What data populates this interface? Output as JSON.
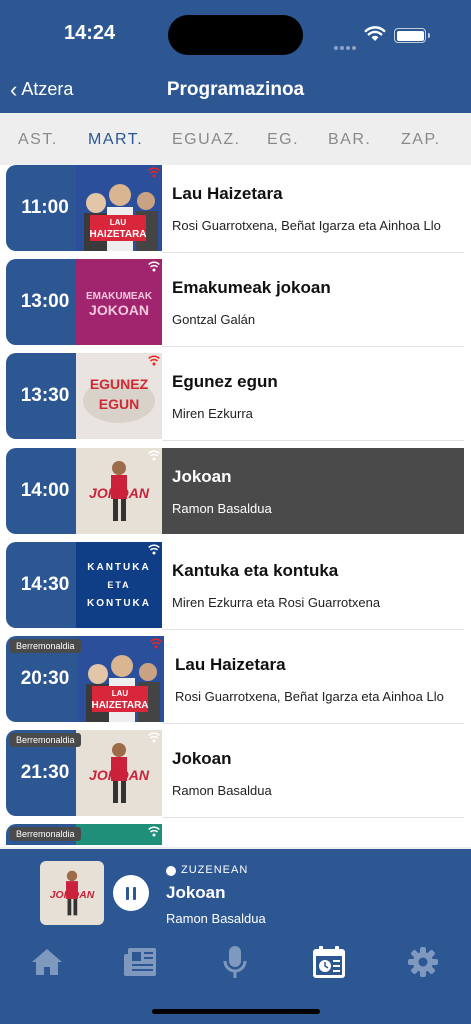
{
  "status_bar": {
    "time": "14:24"
  },
  "nav": {
    "back_label": "Atzera",
    "title": "Programazinoa"
  },
  "days": [
    {
      "label": "AST.",
      "active": false
    },
    {
      "label": "MART.",
      "active": true
    },
    {
      "label": "EGUAZ.",
      "active": false
    },
    {
      "label": "EG.",
      "active": false
    },
    {
      "label": "BAR.",
      "active": false
    },
    {
      "label": "ZAP.",
      "active": false
    }
  ],
  "programs": [
    {
      "time": "11:00",
      "title": "Lau Haizetara",
      "hosts": "Rosi Guarrotxena, Beñat Igarza eta Ainhoa Llo",
      "thumb": "lau-haizetara",
      "current": false,
      "badge": ""
    },
    {
      "time": "13:00",
      "title": "Emakumeak jokoan",
      "hosts": "Gontzal Galán",
      "thumb": "emakumeak-jokoan",
      "current": false,
      "badge": ""
    },
    {
      "time": "13:30",
      "title": "Egunez egun",
      "hosts": "Miren Ezkurra",
      "thumb": "egunez-egun",
      "current": false,
      "badge": ""
    },
    {
      "time": "14:00",
      "title": "Jokoan",
      "hosts": "Ramon Basaldua",
      "thumb": "jokoan",
      "current": true,
      "badge": ""
    },
    {
      "time": "14:30",
      "title": "Kantuka eta kontuka",
      "hosts": "Miren Ezkurra eta Rosi Guarrotxena",
      "thumb": "kantuka",
      "current": false,
      "badge": ""
    },
    {
      "time": "20:30",
      "title": "Lau Haizetara",
      "hosts": "Rosi Guarrotxena, Beñat Igarza eta Ainhoa Llo",
      "thumb": "lau-haizetara",
      "current": false,
      "badge": "Berremonaldia"
    },
    {
      "time": "21:30",
      "title": "Jokoan",
      "hosts": "Ramon Basaldua",
      "thumb": "jokoan",
      "current": false,
      "badge": "Berremonaldia"
    },
    {
      "time": "",
      "title": "",
      "hosts": "",
      "thumb": "green",
      "current": false,
      "badge": "Berremonaldia"
    }
  ],
  "thumb_texts": {
    "lau_haizetara": [
      "LAU",
      "HAIZETARA"
    ],
    "emakumeak_jokoan": [
      "EMAKUMEAK",
      "JOKOAN"
    ],
    "egunez_egun": [
      "EGUNEZ",
      "EGUN"
    ],
    "jokoan": "JOKOAN",
    "kantuka": [
      "KANTUKA",
      "ETA",
      "KONTUKA"
    ]
  },
  "player": {
    "live_label": "ZUZENEAN",
    "title": "Jokoan",
    "host": "Ramon Basaldua"
  },
  "tabbar": [
    {
      "icon": "home-icon"
    },
    {
      "icon": "news-icon"
    },
    {
      "icon": "microphone-icon"
    },
    {
      "icon": "schedule-icon",
      "active": true
    },
    {
      "icon": "settings-icon"
    }
  ],
  "colors": {
    "brand_blue": "#2c5793",
    "active_row": "#4a4a4a",
    "tab_inactive": "#7f98bd",
    "tab_active": "#ffffff"
  }
}
